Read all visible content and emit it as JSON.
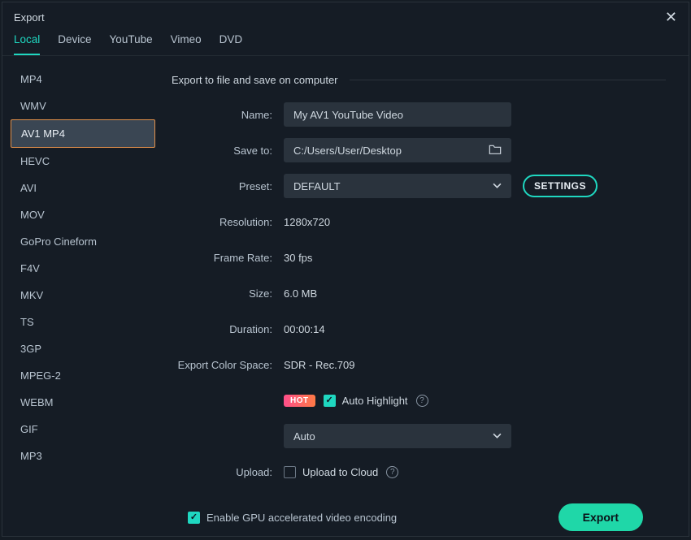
{
  "window": {
    "title": "Export"
  },
  "tabs": [
    {
      "label": "Local",
      "active": true
    },
    {
      "label": "Device",
      "active": false
    },
    {
      "label": "YouTube",
      "active": false
    },
    {
      "label": "Vimeo",
      "active": false
    },
    {
      "label": "DVD",
      "active": false
    }
  ],
  "formats": [
    {
      "label": "MP4",
      "selected": false
    },
    {
      "label": "WMV",
      "selected": false
    },
    {
      "label": "AV1 MP4",
      "selected": true
    },
    {
      "label": "HEVC",
      "selected": false
    },
    {
      "label": "AVI",
      "selected": false
    },
    {
      "label": "MOV",
      "selected": false
    },
    {
      "label": "GoPro Cineform",
      "selected": false
    },
    {
      "label": "F4V",
      "selected": false
    },
    {
      "label": "MKV",
      "selected": false
    },
    {
      "label": "TS",
      "selected": false
    },
    {
      "label": "3GP",
      "selected": false
    },
    {
      "label": "MPEG-2",
      "selected": false
    },
    {
      "label": "WEBM",
      "selected": false
    },
    {
      "label": "GIF",
      "selected": false
    },
    {
      "label": "MP3",
      "selected": false
    }
  ],
  "section": {
    "header": "Export to file and save on computer"
  },
  "labels": {
    "name": "Name:",
    "save_to": "Save to:",
    "preset": "Preset:",
    "resolution": "Resolution:",
    "frame_rate": "Frame Rate:",
    "size": "Size:",
    "duration": "Duration:",
    "color_space": "Export Color Space:",
    "upload": "Upload:"
  },
  "values": {
    "name": "My AV1 YouTube Video",
    "save_to": "C:/Users/User/Desktop",
    "preset": "DEFAULT",
    "resolution": "1280x720",
    "frame_rate": "30 fps",
    "size": "6.0 MB",
    "duration": "00:00:14",
    "color_space": "SDR - Rec.709",
    "auto_highlight_select": "Auto"
  },
  "buttons": {
    "settings": "SETTINGS",
    "export": "Export"
  },
  "badges": {
    "hot": "HOT"
  },
  "checkboxes": {
    "auto_highlight": {
      "label": "Auto Highlight",
      "checked": true
    },
    "upload_cloud": {
      "label": "Upload to Cloud",
      "checked": false
    },
    "gpu": {
      "label": "Enable GPU accelerated video encoding",
      "checked": true
    }
  }
}
